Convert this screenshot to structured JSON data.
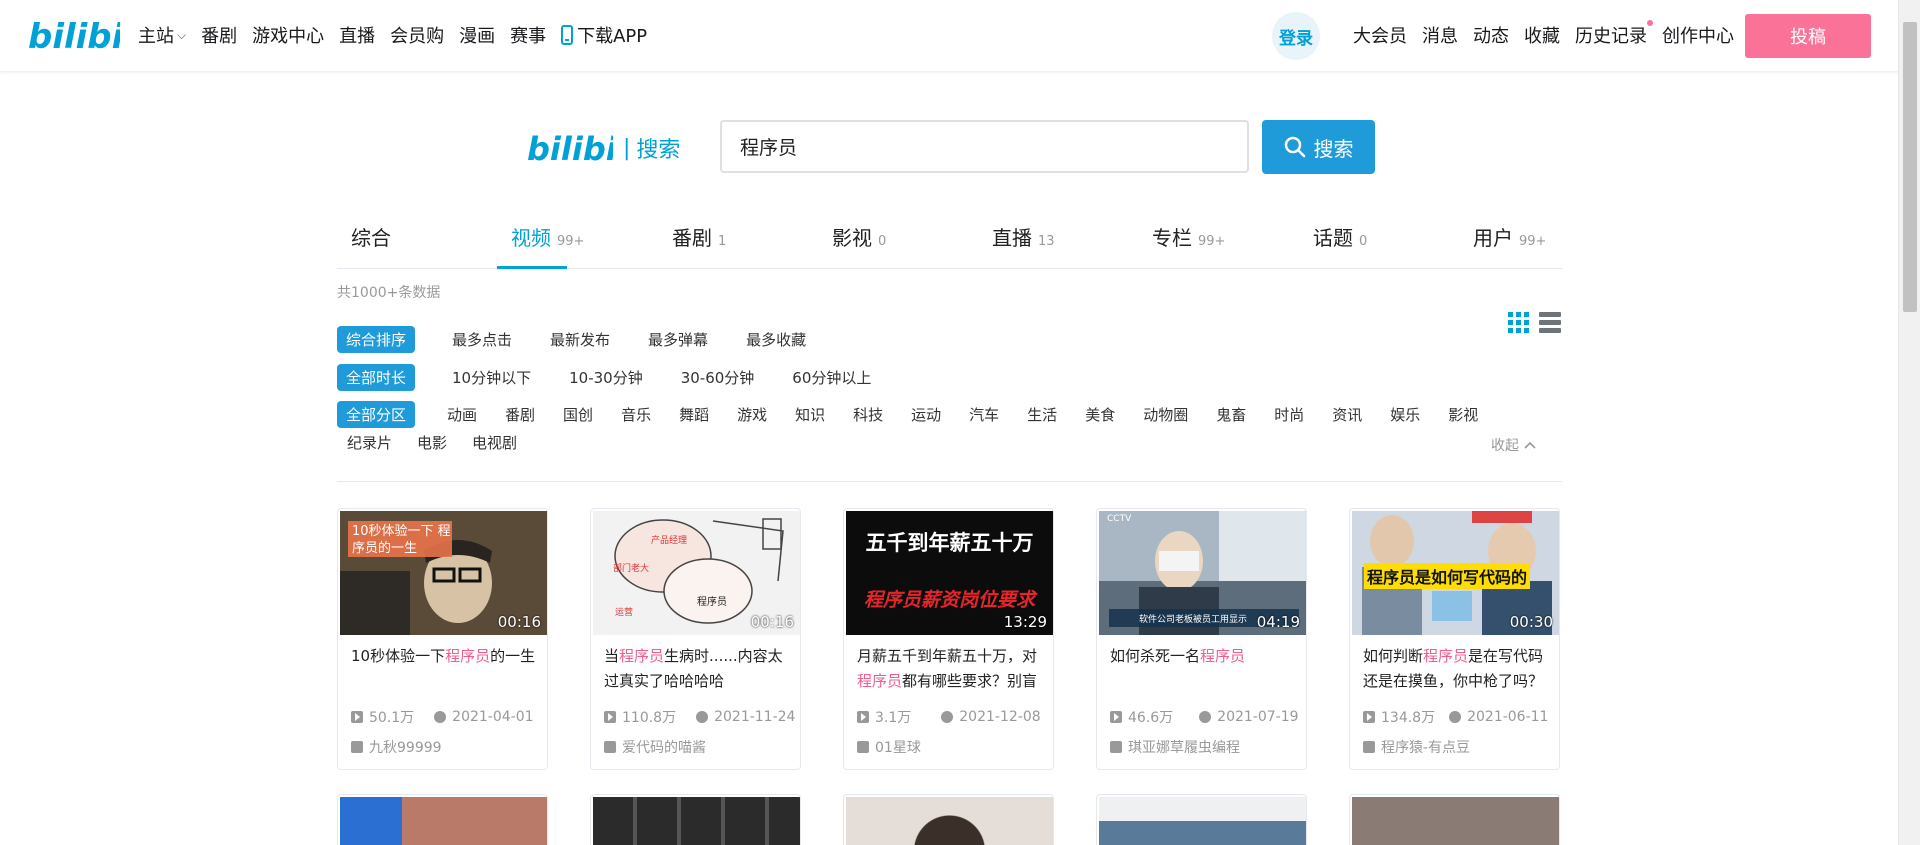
{
  "topnav": {
    "items": [
      {
        "label": "主站",
        "dropdown": true
      },
      {
        "label": "番剧"
      },
      {
        "label": "游戏中心"
      },
      {
        "label": "直播"
      },
      {
        "label": "会员购"
      },
      {
        "label": "漫画"
      },
      {
        "label": "赛事"
      },
      {
        "label": "下载APP",
        "icon": "phone-icon"
      }
    ],
    "login": "登录",
    "right_items": [
      "大会员",
      "消息",
      "动态",
      "收藏",
      "历史记录",
      "创作中心"
    ],
    "upload": "投稿"
  },
  "search": {
    "logo_word": "搜索",
    "query": "程序员",
    "button_label": "搜索"
  },
  "tabs": [
    {
      "label": "综合",
      "count": ""
    },
    {
      "label": "视频",
      "count": "99+"
    },
    {
      "label": "番剧",
      "count": "1"
    },
    {
      "label": "影视",
      "count": "0"
    },
    {
      "label": "直播",
      "count": "13"
    },
    {
      "label": "专栏",
      "count": "99+"
    },
    {
      "label": "话题",
      "count": "0"
    },
    {
      "label": "用户",
      "count": "99+"
    }
  ],
  "total": "共1000+条数据",
  "filters": {
    "order": {
      "active": "综合排序",
      "options": [
        "最多点击",
        "最新发布",
        "最多弹幕",
        "最多收藏"
      ]
    },
    "duration": {
      "active": "全部时长",
      "options": [
        "10分钟以下",
        "10-30分钟",
        "30-60分钟",
        "60分钟以上"
      ]
    },
    "zone": {
      "active": "全部分区",
      "options": [
        "动画",
        "番剧",
        "国创",
        "音乐",
        "舞蹈",
        "游戏",
        "知识",
        "科技",
        "运动",
        "汽车",
        "生活",
        "美食",
        "动物圈",
        "鬼畜",
        "时尚",
        "资讯",
        "娱乐",
        "影视"
      ],
      "options2": [
        "纪录片",
        "电影",
        "电视剧"
      ]
    },
    "collapse": "收起"
  },
  "videos": [
    {
      "title_pre": "10秒体验一下",
      "title_hl": "程序员",
      "title_post": "的一生",
      "duration": "00:16",
      "views": "50.1万",
      "date": "2021-04-01",
      "author": "九秋99999",
      "thumb_text": "10秒体验一下 程序员的一生"
    },
    {
      "title_pre": "当",
      "title_hl": "程序员",
      "title_post": "生病时......内容太过真实了哈哈哈哈",
      "duration": "00:16",
      "views": "110.8万",
      "date": "2021-11-24",
      "author": "爱代码的喵酱",
      "thumb_text": "程序员"
    },
    {
      "title_pre": "月薪五千到年薪五十万，对",
      "title_hl": "程序员",
      "title_post": "都有哪些要求？别盲",
      "duration": "13:29",
      "views": "3.1万",
      "date": "2021-12-08",
      "author": "01星球",
      "thumb_line1": "五千到年薪五十万",
      "thumb_line2": "程序员薪资岗位要求"
    },
    {
      "title_pre": "如何杀死一名",
      "title_hl": "程序员",
      "title_post": "",
      "duration": "04:19",
      "views": "46.6万",
      "date": "2021-07-19",
      "author": "琪亚娜草履虫编程",
      "thumb_text": "软件公司老板被员工用显示"
    },
    {
      "title_pre": "如何判断",
      "title_hl": "程序员",
      "title_post": "是在写代码还是在摸鱼，你中枪了吗？",
      "duration": "00:30",
      "views": "134.8万",
      "date": "2021-06-11",
      "author": "程序猿-有点豆",
      "thumb_text": "程序员是如何写代码的"
    }
  ]
}
